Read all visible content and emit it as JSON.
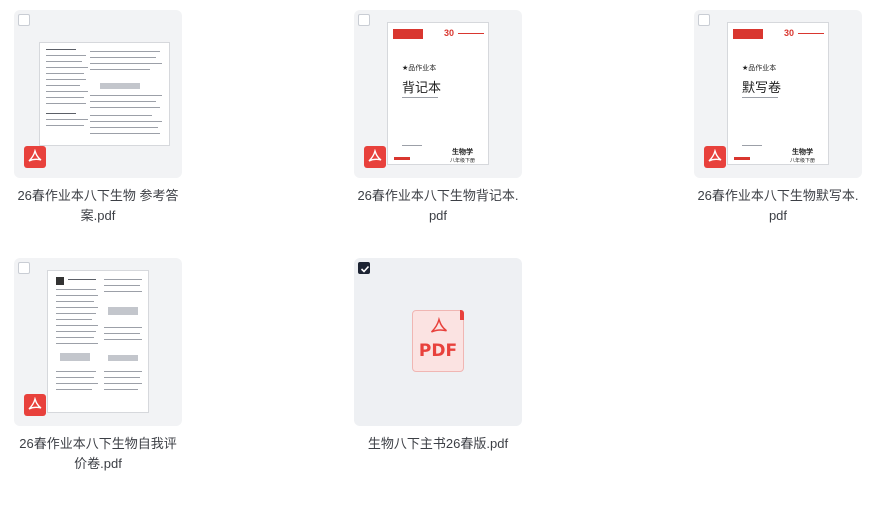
{
  "files": [
    {
      "name": "26春作业本八下生物 参考答案.pdf",
      "selected": false,
      "icon": "pdf-icon"
    },
    {
      "name": "26春作业本八下生物背记本.pdf",
      "selected": false,
      "icon": "pdf-icon"
    },
    {
      "name": "26春作业本八下生物默写本.pdf",
      "selected": false,
      "icon": "pdf-icon"
    },
    {
      "name": "26春作业本八下生物自我评价卷.pdf",
      "selected": false,
      "icon": "pdf-icon"
    },
    {
      "name": "生物八下主书26春版.pdf",
      "selected": true,
      "icon": "pdf-icon"
    }
  ],
  "covers": {
    "memo": {
      "brand": "30",
      "series": "★品作业本",
      "title": "背记本",
      "subject": "生物学",
      "grade": "八年级下册"
    },
    "dictation": {
      "brand": "30",
      "series": "★品作业本",
      "title": "默写卷",
      "subject": "生物学",
      "grade": "八年级下册"
    }
  },
  "placeholder": {
    "label": "PDF"
  },
  "colors": {
    "accent": "#e8413c",
    "thumb_bg": "#f2f3f5",
    "check_on": "#1d2433"
  }
}
